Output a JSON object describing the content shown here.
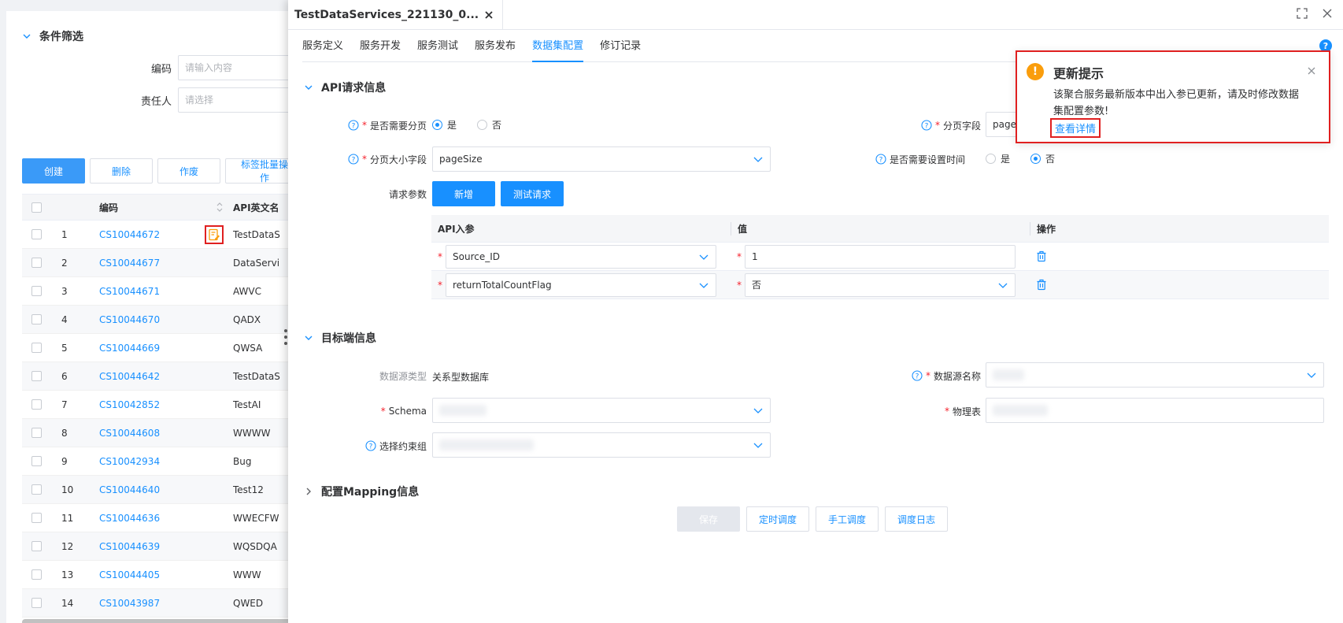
{
  "filter": {
    "title": "条件筛选",
    "fields": [
      {
        "label": "编码",
        "placeholder": "请输入内容"
      },
      {
        "label": "责任人",
        "placeholder": "请选择"
      }
    ]
  },
  "toolbar": {
    "create": "创建",
    "delete": "删除",
    "void": "作废",
    "batch_tag": "标签批量操作"
  },
  "list_table": {
    "columns": [
      "编码",
      "API英文名"
    ],
    "rows": [
      {
        "idx": "1",
        "code": "CS10044672",
        "name": "TestDataS"
      },
      {
        "idx": "2",
        "code": "CS10044677",
        "name": "DataServi"
      },
      {
        "idx": "3",
        "code": "CS10044671",
        "name": "AWVC"
      },
      {
        "idx": "4",
        "code": "CS10044670",
        "name": "QADX"
      },
      {
        "idx": "5",
        "code": "CS10044669",
        "name": "QWSA"
      },
      {
        "idx": "6",
        "code": "CS10044642",
        "name": "TestDataS"
      },
      {
        "idx": "7",
        "code": "CS10042852",
        "name": "TestAI"
      },
      {
        "idx": "8",
        "code": "CS10044608",
        "name": "WWWW"
      },
      {
        "idx": "9",
        "code": "CS10042934",
        "name": "Bug"
      },
      {
        "idx": "10",
        "code": "CS10044640",
        "name": "Test12"
      },
      {
        "idx": "11",
        "code": "CS10044636",
        "name": "WWECFW"
      },
      {
        "idx": "12",
        "code": "CS10044639",
        "name": "WQSDQA"
      },
      {
        "idx": "13",
        "code": "CS10044405",
        "name": "WWW"
      },
      {
        "idx": "14",
        "code": "CS10043987",
        "name": "QWED"
      }
    ]
  },
  "drawer": {
    "title": "TestDataServices_221130_0...",
    "tabs": [
      "服务定义",
      "服务开发",
      "服务测试",
      "服务发布",
      "数据集配置",
      "修订记录"
    ],
    "active_tab": "数据集配置",
    "help": "?"
  },
  "api_section": {
    "title": "API请求信息",
    "need_paging_label": "是否需要分页",
    "need_paging_options": [
      "是",
      "否"
    ],
    "need_paging_value": "是",
    "page_field_label": "分页字段",
    "page_field_value": "page",
    "page_size_label": "分页大小字段",
    "page_size_value": "pageSize",
    "need_time_label": "是否需要设置时间",
    "need_time_options": [
      "是",
      "否"
    ],
    "need_time_value": "否",
    "req_params_label": "请求参数",
    "add_btn": "新增",
    "test_btn": "测试请求",
    "param_table": {
      "columns": [
        "API入参",
        "值",
        "操作"
      ],
      "rows": [
        {
          "param": "Source_ID",
          "value": "1",
          "value_is_select": false
        },
        {
          "param": "returnTotalCountFlag",
          "value": "否",
          "value_is_select": true
        }
      ]
    }
  },
  "target_section": {
    "title": "目标端信息",
    "ds_type_label": "数据源类型",
    "ds_type_value": "关系型数据库",
    "ds_name_label": "数据源名称",
    "schema_label": "Schema",
    "table_label": "物理表",
    "constraint_label": "选择约束组"
  },
  "mapping_section": {
    "title": "配置Mapping信息"
  },
  "footer": {
    "save": "保存",
    "schedule": "定时调度",
    "manual": "手工调度",
    "log": "调度日志"
  },
  "notification": {
    "title": "更新提示",
    "message": "该聚合服务最新版本中出入参已更新，请及时修改数据集配置参数!",
    "link": "查看详情"
  },
  "colors": {
    "primary": "#1890ff",
    "warning": "#fa9d0c",
    "danger": "#e02020",
    "required": "#f5222d"
  }
}
